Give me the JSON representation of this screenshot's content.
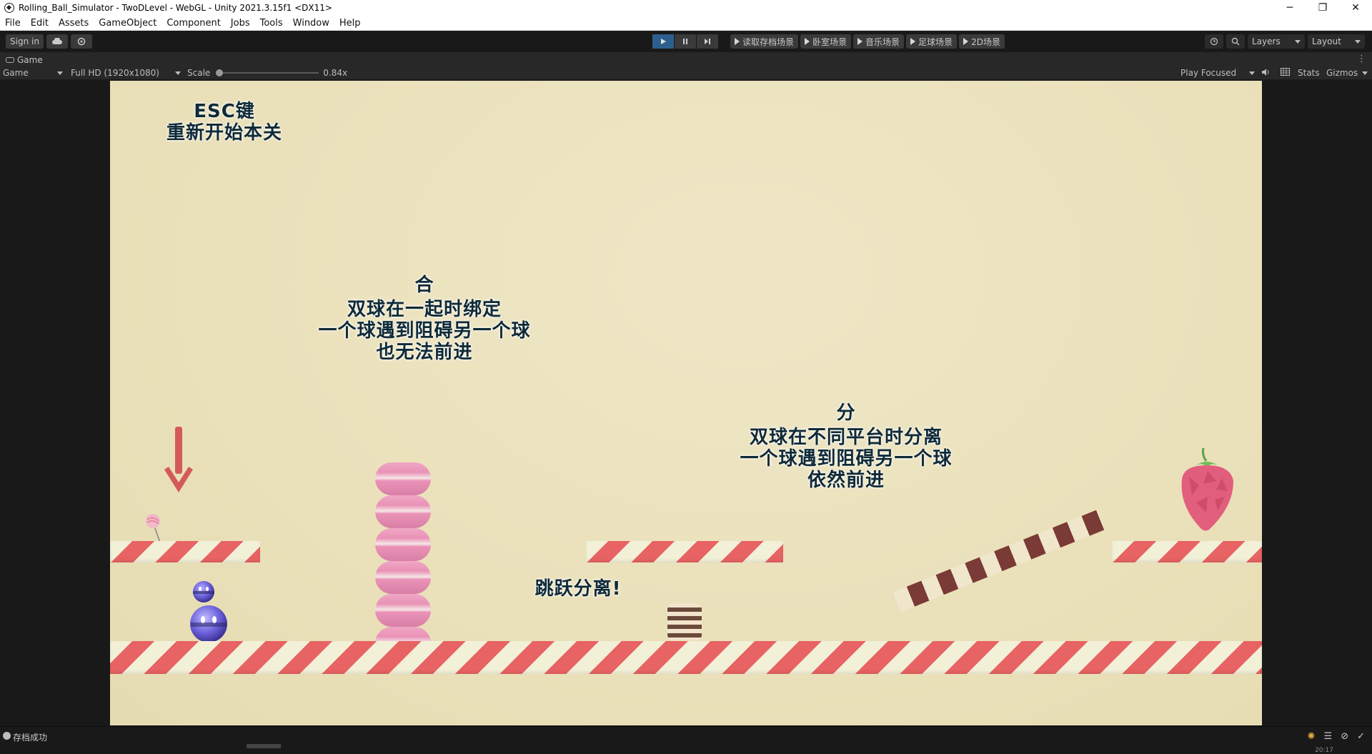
{
  "window": {
    "title": "Rolling_Ball_Simulator - TwoDLevel - WebGL - Unity 2021.3.15f1 <DX11>",
    "minimize": "─",
    "restore": "❐",
    "close": "✕"
  },
  "menubar": {
    "items": [
      "File",
      "Edit",
      "Assets",
      "GameObject",
      "Component",
      "Jobs",
      "Tools",
      "Window",
      "Help"
    ]
  },
  "toolbar": {
    "sign_in": "Sign in",
    "scene_buttons": [
      "读取存档场景",
      "卧室场景",
      "音乐场景",
      "足球场景",
      "2D场景"
    ],
    "layers": "Layers",
    "layout": "Layout"
  },
  "tab": {
    "label": "Game",
    "more": "⋮"
  },
  "gamebar": {
    "display": "Game",
    "resolution": "Full HD (1920x1080)",
    "scale_label": "Scale",
    "scale_value": "0.84x",
    "play_mode": "Play Focused",
    "stats": "Stats",
    "gizmos": "Gizmos"
  },
  "game": {
    "esc_line1": "ESC键",
    "esc_line2": "重新开始本关",
    "merge_title": "合",
    "merge_line1": "双球在一起时绑定",
    "merge_line2": "一个球遇到阻碍另一个球",
    "merge_line3": "也无法前进",
    "split_title": "分",
    "split_line1": "双球在不同平台时分离",
    "split_line2": "一个球遇到阻碍另一个球",
    "split_line3": "依然前进",
    "jump_text": "跳跃分离!"
  },
  "status": {
    "message": "存档成功",
    "time": "20:17"
  },
  "colors": {
    "play_active": "#2d5f8e",
    "stripe_red": "#e86363",
    "text_dark": "#0f2a38"
  }
}
